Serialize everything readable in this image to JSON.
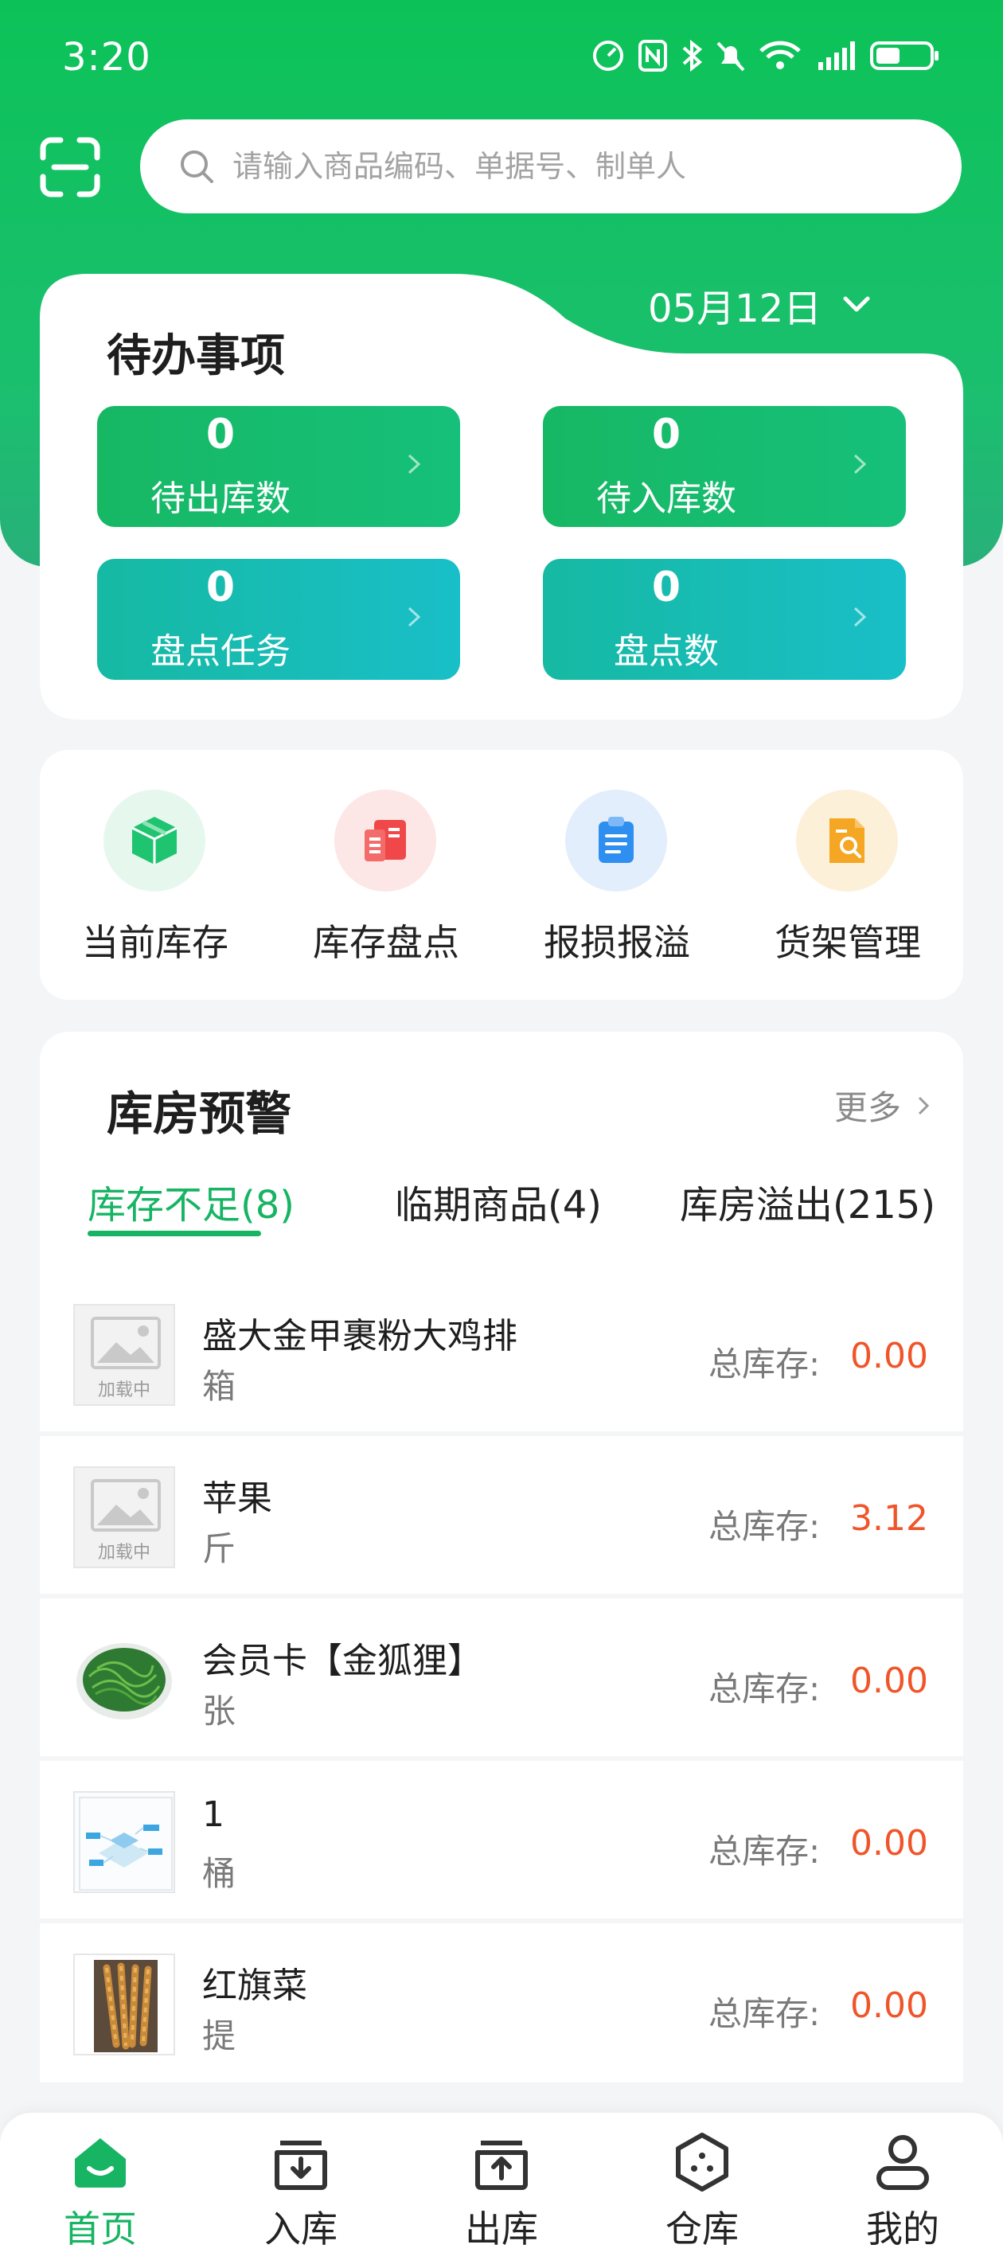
{
  "status_bar": {
    "time": "3:20",
    "battery_level": 0.45
  },
  "search": {
    "placeholder": "请输入商品编码、单据号、制单人"
  },
  "todo": {
    "title": "待办事项",
    "date": "05月12日",
    "tiles": [
      {
        "count": "0",
        "label": "待出库数"
      },
      {
        "count": "0",
        "label": "待入库数"
      },
      {
        "count": "0",
        "label": "盘点任务"
      },
      {
        "count": "0",
        "label": "盘点数"
      }
    ]
  },
  "quick_actions": [
    {
      "label": "当前库存",
      "icon": "box-icon",
      "color": "#1fc470"
    },
    {
      "label": "库存盘点",
      "icon": "inventory-check-icon",
      "color": "#f04848"
    },
    {
      "label": "报损报溢",
      "icon": "clipboard-icon",
      "color": "#2f8ff0"
    },
    {
      "label": "货架管理",
      "icon": "shelf-search-icon",
      "color": "#f5a623"
    }
  ],
  "warehouse_alert": {
    "title": "库房预警",
    "more": "更多",
    "tabs": [
      "库存不足(8)",
      "临期商品(4)",
      "库房溢出(215)"
    ],
    "stock_label": "总库存:",
    "placeholder_text": "加载中",
    "items": [
      {
        "name": "盛大金甲裹粉大鸡排",
        "unit": "箱",
        "stock": "0.00"
      },
      {
        "name": "苹果",
        "unit": "斤",
        "stock": "3.12"
      },
      {
        "name": "会员卡【金狐狸】",
        "unit": "张",
        "stock": "0.00"
      },
      {
        "name": "1",
        "unit": "桶",
        "stock": "0.00"
      },
      {
        "name": "红旗菜",
        "unit": "提",
        "stock": "0.00"
      }
    ]
  },
  "bottom_nav": [
    {
      "label": "首页",
      "icon": "home-icon",
      "active": true
    },
    {
      "label": "入库",
      "icon": "inbound-icon",
      "active": false
    },
    {
      "label": "出库",
      "icon": "outbound-icon",
      "active": false
    },
    {
      "label": "仓库",
      "icon": "warehouse-icon",
      "active": false
    },
    {
      "label": "我的",
      "icon": "user-icon",
      "active": false
    }
  ],
  "colors": {
    "primary": "#16b463",
    "accent_value": "#f0552a",
    "teal": "#19bfc8"
  }
}
